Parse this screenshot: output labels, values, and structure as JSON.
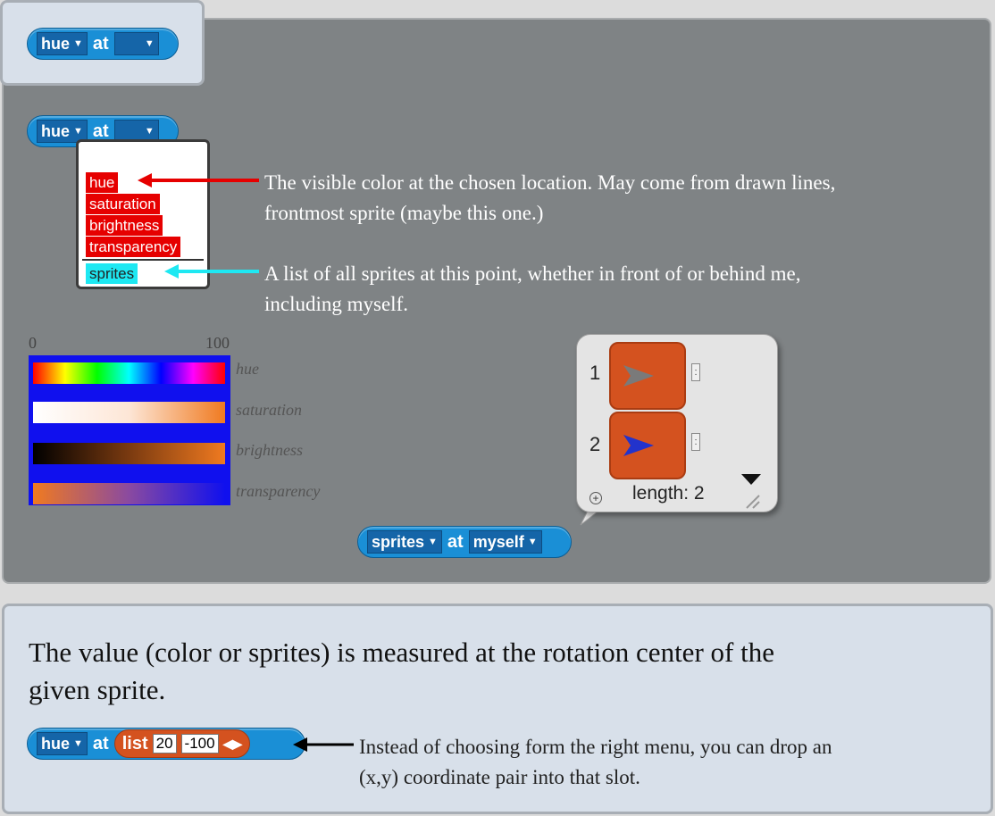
{
  "blocks": {
    "top": {
      "attr": "hue",
      "at": "at",
      "target": ""
    },
    "middle": {
      "attr": "hue",
      "at": "at",
      "target": ""
    },
    "sprites": {
      "attr": "sprites",
      "at": "at",
      "target": "myself"
    },
    "list": {
      "attr": "hue",
      "at": "at",
      "list_label": "list",
      "x": "20",
      "y": "-100"
    }
  },
  "menu": {
    "items": [
      "hue",
      "saturation",
      "brightness",
      "transparency"
    ],
    "extra": "sprites"
  },
  "notes": {
    "color_line1": "The visible color at the chosen location. May come from drawn lines,",
    "color_line2": "frontmost sprite (maybe this one.)",
    "sprites_line1": "A list of all sprites at this point, whether in front of or behind me,",
    "sprites_line2": "including myself."
  },
  "scale": {
    "min": "0",
    "max": "100"
  },
  "bar_labels": [
    "hue",
    "saturation",
    "brightness",
    "transparency"
  ],
  "result_list": {
    "indices": [
      "1",
      "2"
    ],
    "length_text": "length: 2"
  },
  "bottom": {
    "line1": "The value (color or sprites) is measured at the rotation center of the",
    "line2": "given sprite.",
    "note_line1": "Instead of choosing form the right menu, you can drop an",
    "note_line2": "(x,y) coordinate pair into that slot."
  },
  "colors": {
    "block_blue": "#1a8fd6",
    "menu_red": "#e60000",
    "sprites_cyan": "#1ee8f2",
    "list_orange": "#d4521f",
    "panel_grey": "#7f8385",
    "panel_light": "#d8e0ea"
  }
}
